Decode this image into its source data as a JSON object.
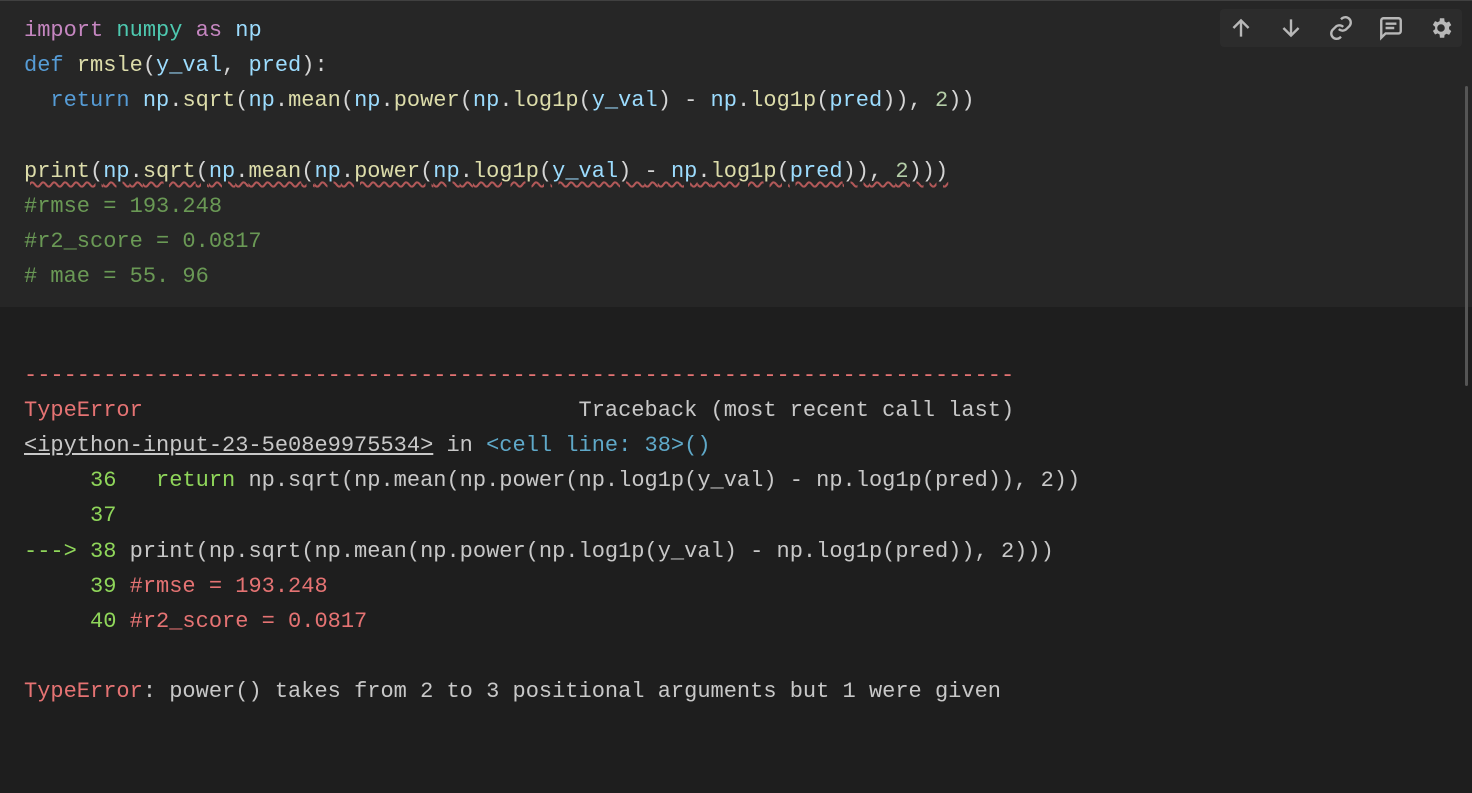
{
  "code": {
    "line1": {
      "import": "import",
      "numpy": "numpy",
      "as": "as",
      "np": "np"
    },
    "line2": {
      "def": "def",
      "rmsle": "rmsle",
      "paren_open": "(",
      "y_val": "y_val",
      "comma": ",",
      "pred": "pred",
      "paren_close": "):"
    },
    "line3": {
      "indent": "  ",
      "return": "return",
      "expr_pre": " np",
      "dot1": ".",
      "sqrt": "sqrt",
      "p1": "(",
      "np2": "np",
      "dot2": ".",
      "mean": "mean",
      "p2": "(",
      "np3": "np",
      "dot3": ".",
      "power": "power",
      "p3": "(",
      "np4": "np",
      "dot4": ".",
      "log1p1": "log1p",
      "p4": "(",
      "yv": "y_val",
      "p5": ") ",
      "minus": "-",
      "np5": " np",
      "dot5": ".",
      "log1p2": "log1p",
      "p6": "(",
      "pr": "pred",
      "p7": "))",
      "comma": ", ",
      "two": "2",
      "p8": "))"
    },
    "line5": {
      "print": "print",
      "p1": "(",
      "np1": "np",
      "dot1": ".",
      "sqrt": "sqrt",
      "p2": "(",
      "np2": "np",
      "dot2": ".",
      "mean": "mean",
      "p3": "(",
      "np3": "np",
      "dot3": ".",
      "power": "power",
      "p4": "(",
      "np4": "np",
      "dot4": ".",
      "log1p1": "log1p",
      "p5": "(",
      "yv": "y_val",
      "p6": ") ",
      "minus": "-",
      "np5": " np",
      "dot5": ".",
      "log1p2": "log1p",
      "p7": "(",
      "pr": "pred",
      "p8": "))",
      "comma": ", ",
      "two": "2",
      "p9": ")))"
    },
    "line6": "#rmse = 193.248",
    "line7": "#r2_score = 0.0817",
    "line8": "# mae = 55. 96"
  },
  "traceback": {
    "sep": "---------------------------------------------------------------------------",
    "errclass": "TypeError",
    "header_spacing": "                                 ",
    "traceback_label": "Traceback (most recent call last)",
    "ipython_input": "<ipython-input-23-5e08e9975534>",
    "in": " in ",
    "cell_line": "<cell line: 38>",
    "cell_paren": "()",
    "l36_num": "     36",
    "l36_space": "   ",
    "l36_return": "return",
    "l36_code": " np.sqrt(np.mean(np.power(np.log1p(y_val) - np.log1p(pred)), 2))",
    "l37_num": "     37",
    "l37_code": " ",
    "arrow": "---> ",
    "l38_num": "38",
    "l38_code": " print(np.sqrt(np.mean(np.power(np.log1p(y_val) - np.log1p(pred)), 2)))",
    "l39_num": "     39",
    "l39_code": " #rmse = 193.248",
    "l40_num": "     40",
    "l40_code": " #r2_score = 0.0817",
    "final_err": "TypeError",
    "final_msg": ": power() takes from 2 to 3 positional arguments but 1 were given"
  }
}
